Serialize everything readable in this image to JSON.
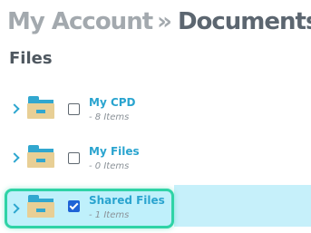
{
  "breadcrumb": {
    "parent": "My Account",
    "separator": "»",
    "current": "Documents"
  },
  "section": {
    "title": "Files"
  },
  "folders": [
    {
      "name": "My CPD",
      "count": "- 8 Items",
      "checked": false,
      "selected": false
    },
    {
      "name": "My Files",
      "count": "- 0 Items",
      "checked": false,
      "selected": false
    },
    {
      "name": "Shared Files",
      "count": "- 1 Items",
      "checked": true,
      "selected": true
    }
  ],
  "colors": {
    "link": "#2aa4cf",
    "selected_background": "#bff0fb",
    "selected_border": "#2fd3a6",
    "checkbox_checked": "#1e63d6",
    "folder_body": "#e8cf95",
    "folder_accent": "#31a7cf"
  },
  "icons": {
    "expand": "chevron-right-icon",
    "folder": "folder-icon",
    "select": "checkbox"
  }
}
